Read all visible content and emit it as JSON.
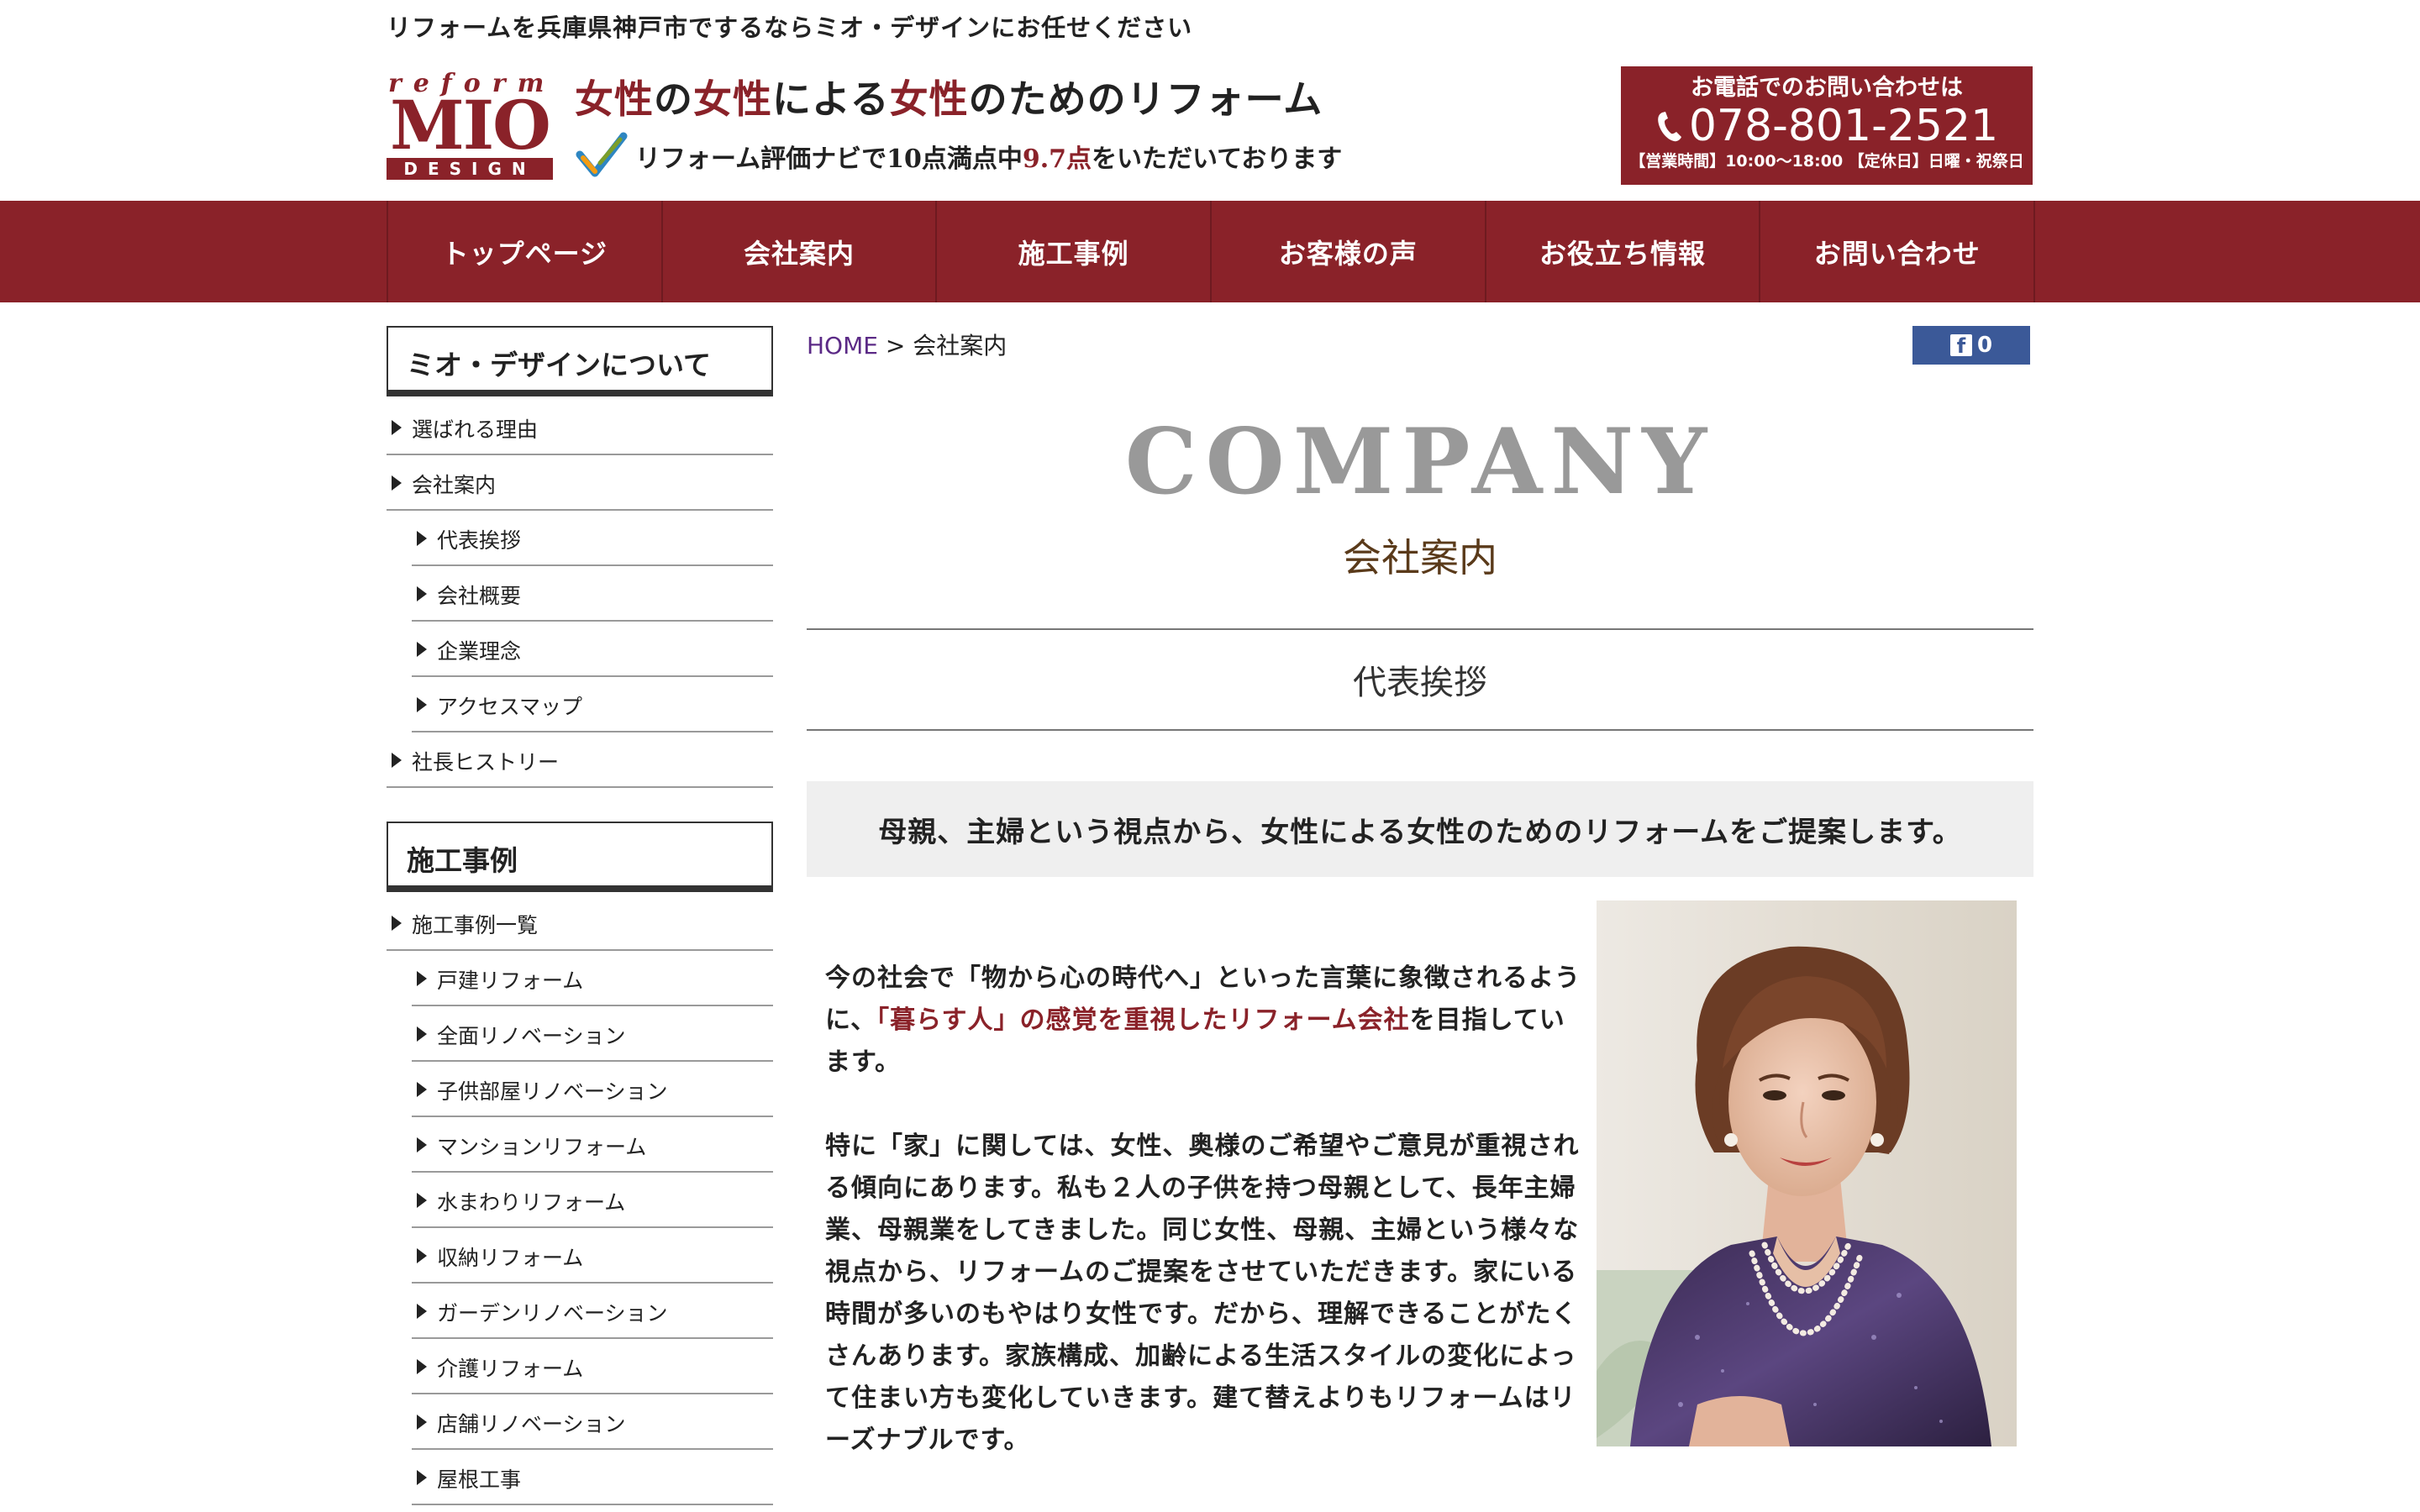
{
  "header": {
    "tagline": "リフォームを兵庫県神戸市でするならミオ・デザインにお任せください",
    "logo": {
      "top": "reform",
      "main": "MIO",
      "bottom": "DESIGN"
    },
    "headline": {
      "part1": "女性",
      "part2": "の",
      "part3": "女性",
      "part4": "による",
      "part5": "女性",
      "part6": "のためのリフォーム"
    },
    "subline": {
      "part1": "リフォーム評価ナビで10点満点中",
      "part2": "9.7点",
      "part3": "をいただいております"
    },
    "phone": {
      "label": "お電話でのお問い合わせは",
      "number": "078-801-2521",
      "hours": "【営業時間】10:00〜18:00 【定休日】日曜・祝祭日"
    }
  },
  "nav": {
    "items": [
      "トップページ",
      "会社案内",
      "施工事例",
      "お客様の声",
      "お役立ち情報",
      "お問い合わせ"
    ]
  },
  "sidebar": {
    "section1": {
      "title": "ミオ・デザインについて",
      "items": [
        {
          "label": "選ばれる理由",
          "level": 1
        },
        {
          "label": "会社案内",
          "level": 1
        },
        {
          "label": "代表挨拶",
          "level": 2
        },
        {
          "label": "会社概要",
          "level": 2
        },
        {
          "label": "企業理念",
          "level": 2
        },
        {
          "label": "アクセスマップ",
          "level": 2
        },
        {
          "label": "社長ヒストリー",
          "level": 1
        }
      ]
    },
    "section2": {
      "title": "施工事例",
      "items": [
        {
          "label": "施工事例一覧",
          "level": 1
        },
        {
          "label": "戸建リフォーム",
          "level": 2
        },
        {
          "label": "全面リノベーション",
          "level": 2
        },
        {
          "label": "子供部屋リノベーション",
          "level": 2
        },
        {
          "label": "マンションリフォーム",
          "level": 2
        },
        {
          "label": "水まわりリフォーム",
          "level": 2
        },
        {
          "label": "収納リフォーム",
          "level": 2
        },
        {
          "label": "ガーデンリノベーション",
          "level": 2
        },
        {
          "label": "介護リフォーム",
          "level": 2
        },
        {
          "label": "店舗リノベーション",
          "level": 2
        },
        {
          "label": "屋根工事",
          "level": 2
        }
      ]
    }
  },
  "breadcrumb": {
    "home": "HOME",
    "separator": ">",
    "current": "会社案内"
  },
  "facebook": {
    "icon": "f",
    "count": "0"
  },
  "main": {
    "title_en": "COMPANY",
    "title_ja": "会社案内",
    "section_title": "代表挨拶",
    "lead": "母親、主婦という視点から、女性による女性のためのリフォームをご提案します。",
    "para1": {
      "a": "今の社会で「物から心の時代へ」といった言葉に象徴されるように、",
      "b": "「暮らす人」の感覚を重視したリフォーム会社",
      "c": "を目指しています。"
    },
    "para2": "特に「家」に関しては、女性、奥様のご希望やご意見が重視される傾向にあります。私も２人の子供を持つ母親として、長年主婦業、母親業をしてきました。同じ女性、母親、主婦という様々な視点から、リフォームのご提案をさせていただきます。家にいる時間が多いのもやはり女性です。だから、理解できることがたくさんあります。家族構成、加齢による生活スタイルの変化によって住まい方も変化していきます。建て替えよりもリフォームはリーズナブルです。"
  },
  "colors": {
    "brand": "#8a2229",
    "facebook": "#3b5998",
    "link": "#5b2a86"
  }
}
